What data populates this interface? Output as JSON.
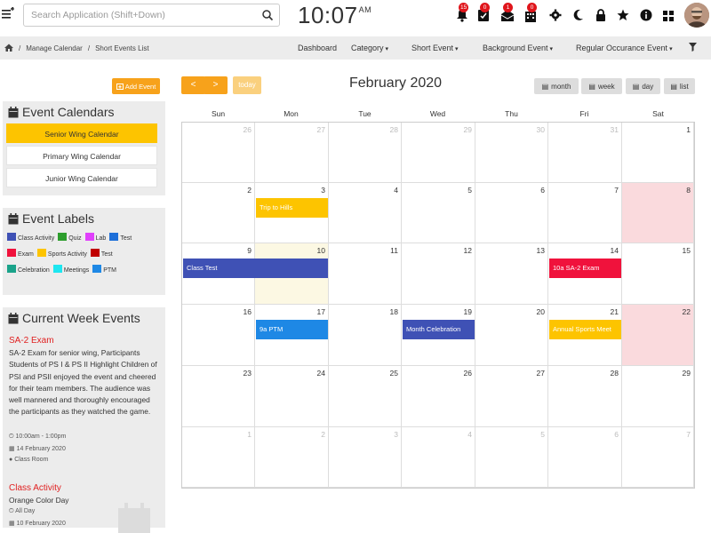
{
  "search": {
    "placeholder": "Search Application (Shift+Down)"
  },
  "clock": {
    "time": "10:07",
    "ampm": "AM"
  },
  "notifications": [
    {
      "icon": "bell-icon",
      "count": "15"
    },
    {
      "icon": "clipboard-icon",
      "count": "0"
    },
    {
      "icon": "mail-icon",
      "count": "1"
    },
    {
      "icon": "building-icon",
      "count": "0"
    }
  ],
  "breadcrumb": {
    "home": "🏠",
    "items": [
      "Manage Calendar",
      "Short Events List"
    ]
  },
  "nav": {
    "dashboard": "Dashboard",
    "category": "Category",
    "short_event": "Short Event",
    "background_event": "Background Event",
    "regular_event": "Regular Occurance Event"
  },
  "sidebar": {
    "add_event": "Add Event",
    "calendars_title": "Event Calendars",
    "calendars": [
      "Senior Wing Calendar",
      "Primary Wing Calendar",
      "Junior Wing Calendar"
    ],
    "labels_title": "Event Labels",
    "labels": [
      {
        "name": "Class Activity",
        "color": "#3f51b5"
      },
      {
        "name": "Quiz",
        "color": "#2e9e2e"
      },
      {
        "name": "Lab",
        "color": "#e040fb"
      },
      {
        "name": "Test",
        "color": "#1e6fd9"
      },
      {
        "name": "Exam",
        "color": "#f0123c"
      },
      {
        "name": "Sports Activity",
        "color": "#fdc400"
      },
      {
        "name": "Test",
        "color": "#c00000"
      },
      {
        "name": "Celebration",
        "color": "#1aa38a"
      },
      {
        "name": "Meetings",
        "color": "#1ee6f0"
      },
      {
        "name": "PTM",
        "color": "#1e88e5"
      }
    ],
    "week_title": "Current Week Events",
    "events": [
      {
        "title": "SA-2 Exam",
        "desc": "SA-2 Exam for senior wing, Participants Students of PS I & PS II Highlight Children of PSI and PSII enjoyed the event and cheered for their team members. The audience was well mannered and thoroughly encouraged the participants as they watched the game.",
        "time": "10:00am - 1:00pm",
        "date": "14 February 2020",
        "place": "Class Room"
      },
      {
        "title": "Class Activity",
        "desc": "Orange Color Day",
        "time": "All Day",
        "date": "10 February 2020"
      }
    ]
  },
  "calendar": {
    "title": "February 2020",
    "prev": "<",
    "next": ">",
    "today": "today",
    "views": [
      "month",
      "week",
      "day",
      "list"
    ],
    "days": [
      "Sun",
      "Mon",
      "Tue",
      "Wed",
      "Thu",
      "Fri",
      "Sat"
    ],
    "weeks": [
      [
        "26",
        "27",
        "28",
        "29",
        "30",
        "31",
        "1"
      ],
      [
        "2",
        "3",
        "4",
        "5",
        "6",
        "7",
        "8"
      ],
      [
        "9",
        "10",
        "11",
        "12",
        "13",
        "14",
        "15"
      ],
      [
        "16",
        "17",
        "18",
        "19",
        "20",
        "21",
        "22"
      ],
      [
        "23",
        "24",
        "25",
        "26",
        "27",
        "28",
        "29"
      ],
      [
        "1",
        "2",
        "3",
        "4",
        "5",
        "6",
        "7"
      ]
    ],
    "events": [
      {
        "label": "Trip to Hills",
        "color": "#fdc400"
      },
      {
        "label": "Class Test",
        "color": "#3f51b5"
      },
      {
        "label": "10a SA-2 Exam",
        "color": "#f0123c"
      },
      {
        "label": "9a PTM",
        "color": "#1e88e5"
      },
      {
        "label": "Month Celebration",
        "color": "#3f51b5"
      },
      {
        "label": "Annual Sports Meet",
        "color": "#fdc400"
      }
    ]
  }
}
